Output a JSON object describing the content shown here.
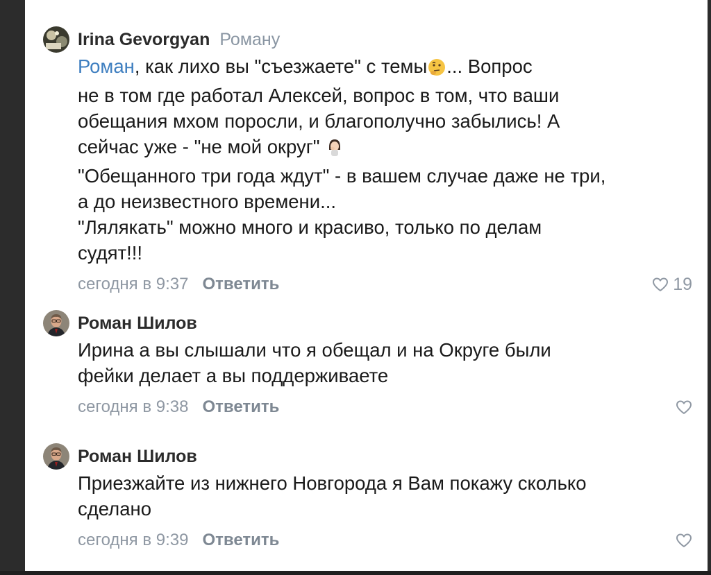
{
  "comments": [
    {
      "author": "Irina Gevorgyan",
      "reply_to": "Роману",
      "mention": "Роман",
      "lines": [
        ", как лихо вы \"съезжаете\" с темы",
        "... Вопрос",
        "не в том где работал Алексей, вопрос в том, что ваши",
        "обещания мхом поросли, и благополучно забылись! А",
        "сейчас уже - \"не мой округ\" ",
        "\"Обещанного три года ждут\" - в вашем случае даже не три,",
        "а до неизвестного времени...",
        "\"Лялякать\" можно много и красиво, только по делам",
        "судят!!!"
      ],
      "emojis": [
        "thinking-face-emoji",
        "facepalm-emoji"
      ],
      "time": "сегодня в 9:37",
      "reply_label": "Ответить",
      "likes": "19"
    },
    {
      "author": "Роман Шилов",
      "lines": [
        "Ирина а вы слышали что я обещал и на Округе были",
        "фейки делает а вы поддерживаете"
      ],
      "time": "сегодня в 9:38",
      "reply_label": "Ответить"
    },
    {
      "author": "Роман Шилов",
      "lines": [
        "Приезжайте из нижнего Новгорода я Вам покажу сколько",
        "сделано"
      ],
      "time": "сегодня в 9:39",
      "reply_label": "Ответить"
    }
  ],
  "colors": {
    "mention": "#3f7fc0",
    "meta": "#8f98a3",
    "reply_to": "#8a96a3"
  }
}
